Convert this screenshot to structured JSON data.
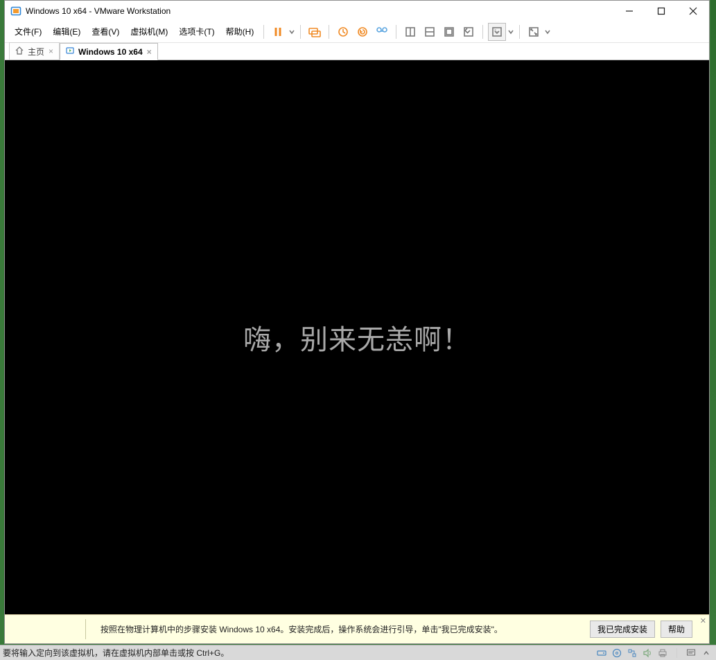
{
  "title": "Windows 10 x64 - VMware Workstation",
  "menus": {
    "file": "文件(F)",
    "edit": "编辑(E)",
    "view": "查看(V)",
    "vm": "虚拟机(M)",
    "tabs": "选项卡(T)",
    "help": "帮助(H)"
  },
  "toolbar_icons": {
    "suspend": "suspend-icon",
    "dropdown": "dropdown-icon",
    "devices": "devices-icon",
    "snap_take": "snapshot-take-icon",
    "snap_revert": "snapshot-revert-icon",
    "snap_manage": "snapshot-manager-icon",
    "view_single": "single-window-icon",
    "view_multi": "multi-window-icon",
    "view_unity": "unity-icon",
    "view_console": "console-view-icon",
    "view_fullscreen_console": "fullscreen-console-icon",
    "fullscreen": "fullscreen-icon"
  },
  "tabs": {
    "home": "主页",
    "vm_name": "Windows 10 x64"
  },
  "vm_screen": {
    "greeting": "嗨，别来无恙啊！"
  },
  "infobar": {
    "message": "按照在物理计算机中的步骤安装 Windows 10 x64。安装完成后，操作系统会进行引导，单击\"我已完成安装\"。",
    "finish_btn": "我已完成安装",
    "help_btn": "帮助"
  },
  "statusbar": {
    "message": "要将输入定向到该虚拟机，请在虚拟机内部单击或按 Ctrl+G。"
  }
}
